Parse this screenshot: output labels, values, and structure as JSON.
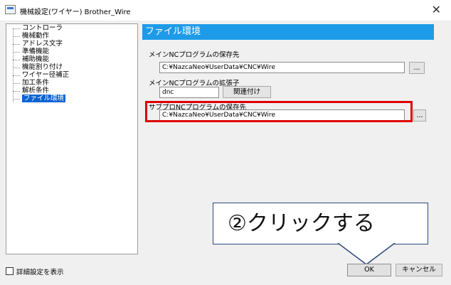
{
  "window": {
    "title": "機械設定(ワイヤー) Brother_Wire",
    "close": "✕"
  },
  "tree": {
    "items": [
      {
        "label": "コントローラ"
      },
      {
        "label": "機械動作"
      },
      {
        "label": "アドレス文字"
      },
      {
        "label": "準備機能"
      },
      {
        "label": "補助機能"
      },
      {
        "label": "機能割り付け"
      },
      {
        "label": "ワイヤー径補正"
      },
      {
        "label": "加工条件"
      },
      {
        "label": "解析条件"
      },
      {
        "label": "ファイル環境",
        "selected": true
      }
    ]
  },
  "panel": {
    "header": "ファイル環境",
    "main_nc_save": {
      "label": "メインNCプログラムの保存先",
      "value": "C:¥NazcaNeo¥UserData¥CNC¥Wire",
      "browse": "..."
    },
    "main_nc_ext": {
      "label": "メインNCプログラムの拡張子",
      "value": "dnc",
      "associate": "関連付け"
    },
    "sub_nc_save": {
      "label": "サブプロNCプログラムの保存先",
      "value": "C:¥NazcaNeo¥UserData¥CNC¥Wire",
      "browse": "..."
    }
  },
  "callout": {
    "text": "②クリックする"
  },
  "footer": {
    "show_detail_label": "詳細設定を表示",
    "show_detail_checked": false,
    "ok": "OK",
    "cancel": "キャンセル"
  },
  "colors": {
    "header_bg": "#1e9be8",
    "highlight": "#e00000",
    "selection": "#0a64d2"
  }
}
